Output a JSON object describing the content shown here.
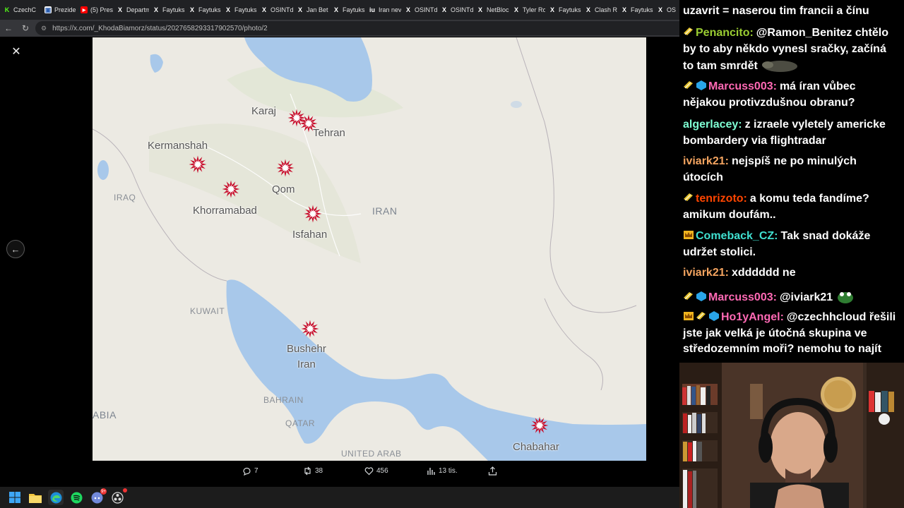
{
  "browser": {
    "tabs": [
      {
        "label": "CzechC",
        "icon": "k-icon",
        "color": "#53fc18"
      },
      {
        "label": "Prezide",
        "icon": "page-icon",
        "color": "#ffffff"
      },
      {
        "label": "(5) Pres",
        "icon": "youtube-icon",
        "color": "#ff0000"
      },
      {
        "label": "Departm",
        "icon": "x-icon",
        "color": "#ffffff"
      },
      {
        "label": "Faytuks",
        "icon": "x-icon",
        "color": "#ffffff"
      },
      {
        "label": "Faytuks",
        "icon": "x-icon",
        "color": "#ffffff"
      },
      {
        "label": "Faytuks",
        "icon": "x-icon",
        "color": "#ffffff"
      },
      {
        "label": "OSINTd",
        "icon": "x-icon",
        "color": "#ffffff"
      },
      {
        "label": "Jan Bet",
        "icon": "x-icon",
        "color": "#ffffff"
      },
      {
        "label": "Faytuks",
        "icon": "x-icon",
        "color": "#ffffff"
      },
      {
        "label": "Iran nev",
        "icon": "iu-icon",
        "color": "#ffffff"
      },
      {
        "label": "OSINTd",
        "icon": "x-icon",
        "color": "#ffffff"
      },
      {
        "label": "OSINTd",
        "icon": "x-icon",
        "color": "#ffffff"
      },
      {
        "label": "NetBloc",
        "icon": "x-icon",
        "color": "#ffffff"
      },
      {
        "label": "Tyler Ro",
        "icon": "x-icon",
        "color": "#ffffff"
      },
      {
        "label": "Faytuks",
        "icon": "x-icon",
        "color": "#ffffff"
      },
      {
        "label": "Clash Re",
        "icon": "x-icon",
        "color": "#ffffff"
      },
      {
        "label": "Faytuks",
        "icon": "x-icon",
        "color": "#ffffff"
      },
      {
        "label": "OS",
        "icon": "x-icon",
        "color": "#ffffff"
      }
    ],
    "url": "https://x.com/_KhodaBiamorz/status/2027658293317902570/photo/2"
  },
  "map": {
    "cities": [
      {
        "name": "Karaj"
      },
      {
        "name": "Tehran"
      },
      {
        "name": "Kermanshah"
      },
      {
        "name": "Qom"
      },
      {
        "name": "Khorramabad"
      },
      {
        "name": "Isfahan"
      },
      {
        "name": "Bushehr\nIran"
      },
      {
        "name": "Chabahar"
      }
    ],
    "countries": [
      "IRAQ",
      "IRAN",
      "KUWAIT",
      "BAHRAIN",
      "QATAR",
      "ABIA",
      "UNITED ARAB"
    ],
    "strike_color": "#c8102e"
  },
  "actions": {
    "replies": "7",
    "reposts": "38",
    "likes": "456",
    "views": "13 tis."
  },
  "chat": {
    "messages": [
      {
        "user": "",
        "text": "uzavrit = naserou tim francii a čínu",
        "color": "#ffffff"
      },
      {
        "user": "Penancito:",
        "text": "@Ramon_Benitez chtělo by to aby někdo vynesl sračky, začíná to tam smrdět",
        "color": "#9acd32"
      },
      {
        "user": "Marcuss003:",
        "text": "má íran vůbec nějakou protivzdušnou obranu?",
        "color": "#ff69b4"
      },
      {
        "user": "algerlacey:",
        "text": "z izraele vyletely americke bombardery via flightradar",
        "color": "#7fffd4"
      },
      {
        "user": "iviark21:",
        "text": "nejspíš ne po minulých útocích",
        "color": "#f4a460"
      },
      {
        "user": "tenrizoto:",
        "text": "a komu teda fandíme? amikum doufám..",
        "color": "#ff4500"
      },
      {
        "user": "Comeback_CZ:",
        "text": "Tak snad dokáže udržet stolici.",
        "color": "#40e0d0"
      },
      {
        "user": "iviark21:",
        "text": "xdddddd ne",
        "color": "#f4a460"
      },
      {
        "user": "Marcuss003:",
        "text": "@iviark21",
        "color": "#ff69b4"
      },
      {
        "user": "Ho1yAngel:",
        "text": "@czechhcloud řešili jste jak velká je útočná skupina ve středozemním moři? nemohu to najít",
        "color": "#ff69b4"
      }
    ]
  },
  "taskbar": {
    "apps": [
      "windows-start-icon",
      "file-explorer-icon",
      "edge-icon",
      "spotify-icon",
      "discord-icon",
      "obs-icon"
    ],
    "discord_badge": "9+"
  }
}
